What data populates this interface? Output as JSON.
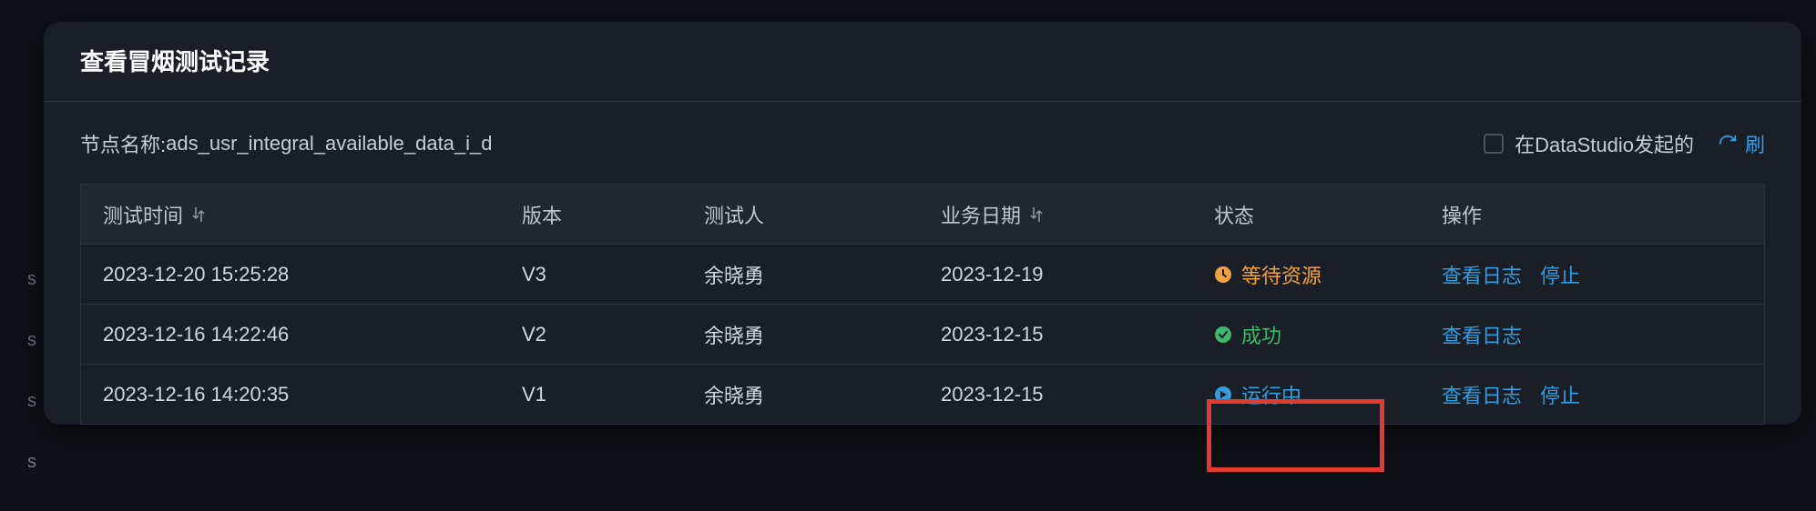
{
  "modal": {
    "title": "查看冒烟测试记录"
  },
  "node": {
    "label": "节点名称: ",
    "value": "ads_usr_integral_available_data_i_d"
  },
  "filter": {
    "checkbox_label": "在DataStudio发起的"
  },
  "refresh": {
    "label": "刷"
  },
  "columns": {
    "test_time": "测试时间",
    "version": "版本",
    "tester": "测试人",
    "biz_date": "业务日期",
    "status": "状态",
    "actions": "操作"
  },
  "status_labels": {
    "wait": "等待资源",
    "success": "成功",
    "running": "运行中"
  },
  "action_labels": {
    "view_log": "查看日志",
    "stop": "停止"
  },
  "rows": [
    {
      "time": "2023-12-20 15:25:28",
      "version": "V3",
      "tester": "余晓勇",
      "biz_date": "2023-12-19",
      "status": "wait",
      "show_stop": true
    },
    {
      "time": "2023-12-16 14:22:46",
      "version": "V2",
      "tester": "余晓勇",
      "biz_date": "2023-12-15",
      "status": "success",
      "show_stop": false
    },
    {
      "time": "2023-12-16 14:20:35",
      "version": "V1",
      "tester": "余晓勇",
      "biz_date": "2023-12-15",
      "status": "running",
      "show_stop": true
    }
  ]
}
